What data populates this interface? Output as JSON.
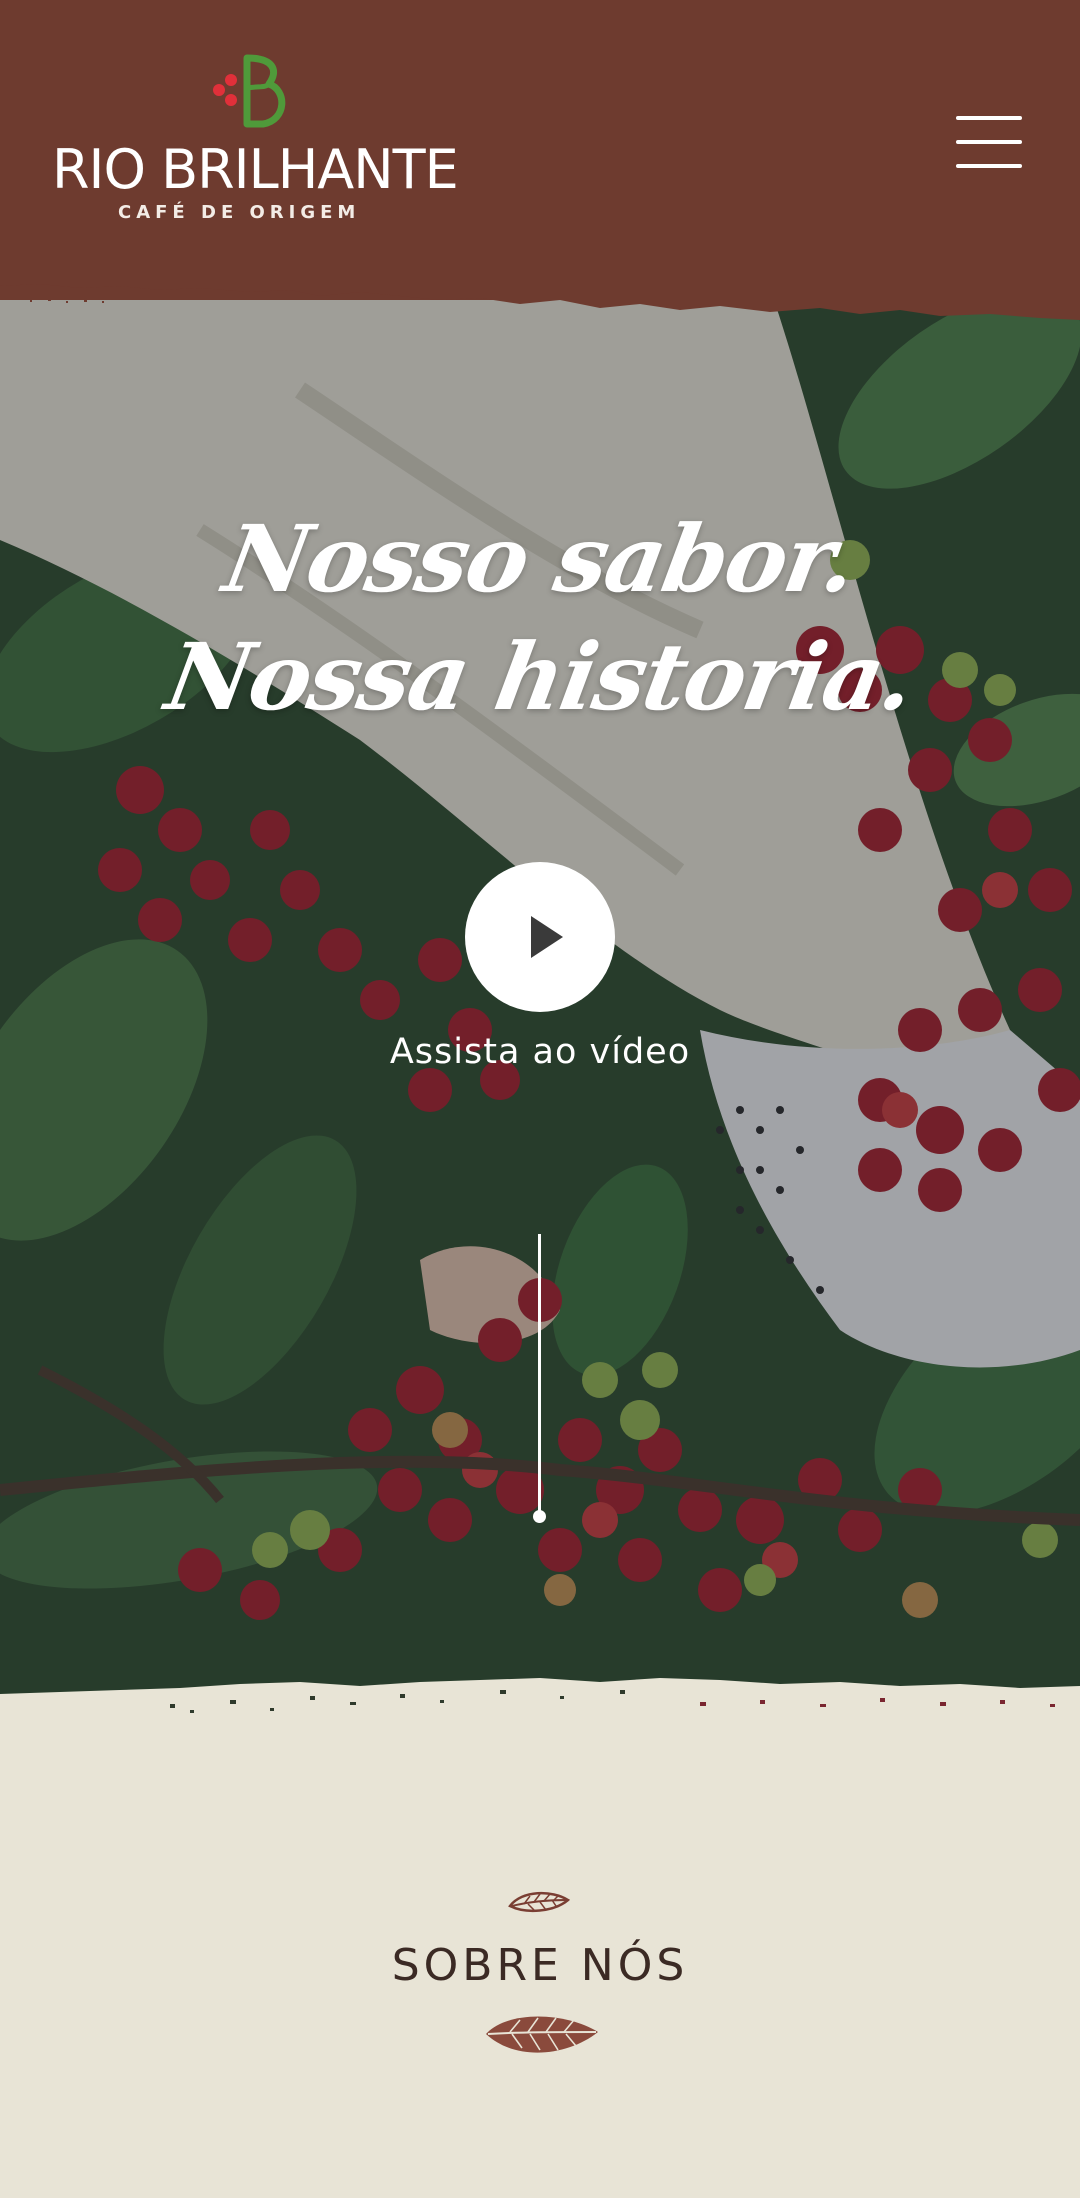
{
  "header": {
    "brand_name": "RIO BRILHANTE",
    "brand_tagline": "CAFÉ DE ORIGEM",
    "menu_icon": "hamburger-menu-icon"
  },
  "hero": {
    "headline_line1": "Nosso sabor.",
    "headline_line2": "Nossa historia.",
    "play_icon": "play-icon",
    "video_label": "Assista ao vídeo"
  },
  "about": {
    "title": "SOBRE NÓS",
    "leaf_icon": "coffee-leaf-icon"
  },
  "colors": {
    "header_bg": "#6e3b2f",
    "page_bg": "#e8e4d6",
    "accent_red": "#e0303a",
    "accent_green": "#4f9a3a",
    "title_text": "#3b2a24"
  }
}
